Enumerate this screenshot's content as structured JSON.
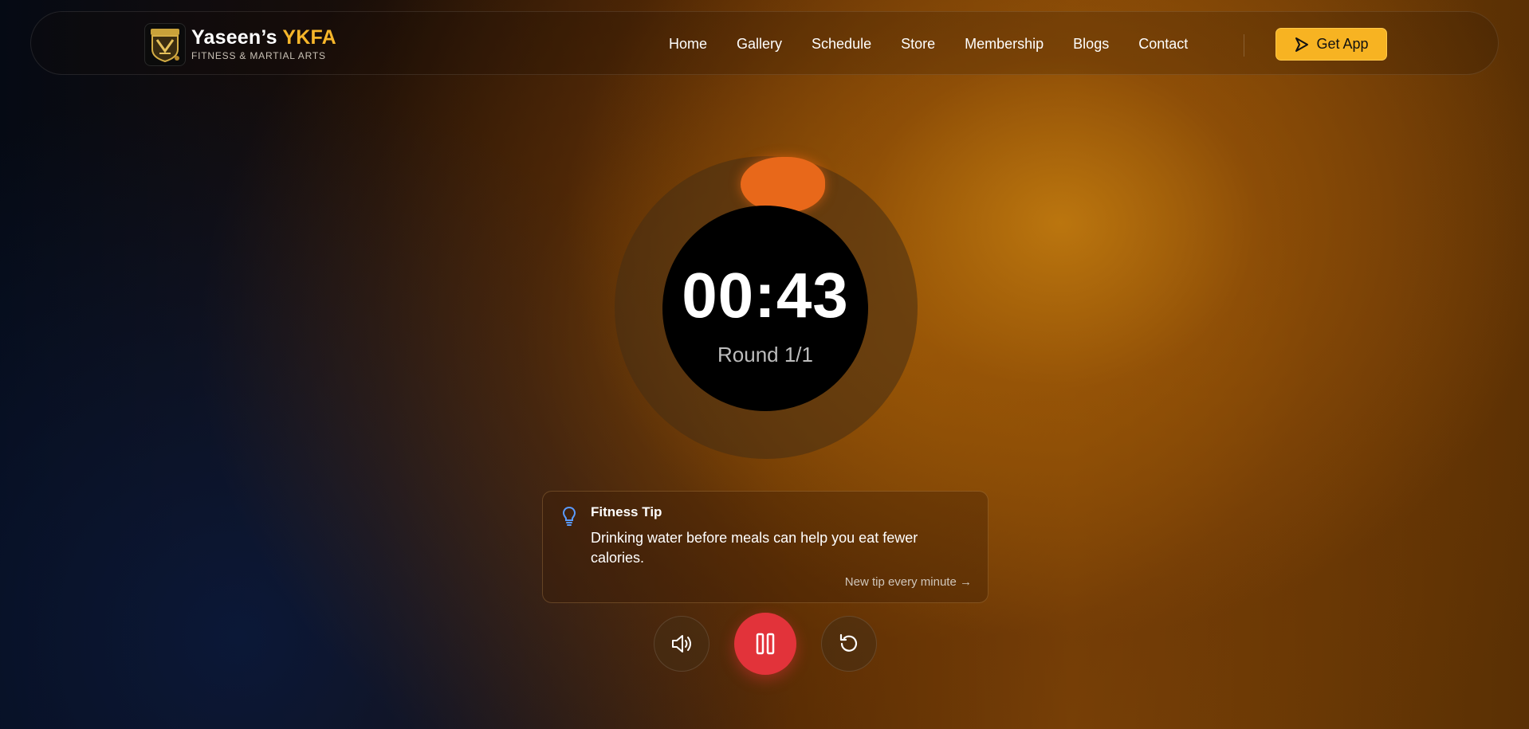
{
  "header": {
    "brand_name": "Yaseen’s",
    "brand_accent": "YKFA",
    "brand_subtitle": "FITNESS & MARTIAL ARTS",
    "logo_icon": "ykfa-shield-logo",
    "nav": [
      {
        "label": "Home"
      },
      {
        "label": "Gallery"
      },
      {
        "label": "Schedule"
      },
      {
        "label": "Store"
      },
      {
        "label": "Membership"
      },
      {
        "label": "Blogs"
      },
      {
        "label": "Contact"
      }
    ],
    "cta_label": "Get App",
    "cta_icon": "arrow-play-icon",
    "accent_color": "#f7b322"
  },
  "timer": {
    "time": "00:43",
    "round": "Round 1/1",
    "ring_color": "#e8681a"
  },
  "tip": {
    "title": "Fitness Tip",
    "text": "Drinking water before meals can help you eat fewer calories.",
    "footer": "New tip every minute",
    "icon": "lightbulb-icon"
  },
  "controls": {
    "sound_icon": "speaker-icon",
    "pause_icon": "pause-icon",
    "reset_icon": "reset-icon",
    "pause_color": "#e2333a"
  }
}
